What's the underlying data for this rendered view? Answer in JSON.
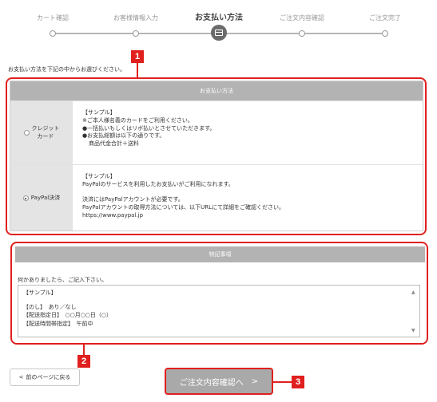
{
  "steps": [
    {
      "label": "カート確認",
      "active": false
    },
    {
      "label": "お客様情報入力",
      "active": false
    },
    {
      "label": "お支払い方法",
      "active": true
    },
    {
      "label": "ご注文内容確認",
      "active": false
    },
    {
      "label": "ご注文完了",
      "active": false
    }
  ],
  "instruction": "お支払い方法を下記の中からお選びください。",
  "payment": {
    "header": "お支払い方法",
    "options": [
      {
        "label_line1": "クレジット",
        "label_line2": "カード",
        "selected": false,
        "lines": [
          "【サンプル】",
          "※ご本人様名義のカードをご利用ください。",
          "●一括払いもしくはリボ払いとさせていただきます。",
          "●お支払総額は以下の通りです。",
          "商品代金合計＋送料"
        ]
      },
      {
        "label_line1": "PayPal決済",
        "selected": true,
        "lines": [
          "【サンプル】",
          "PayPalのサービスを利用したお支払いがご利用になれます。",
          "",
          "決済にはPayPalアカウントが必要です。",
          "PayPalアカウントの取得方法については、以下URLにて詳細をご確認ください。",
          "https://www.paypal.jp"
        ]
      }
    ]
  },
  "notes": {
    "header": "特記事項",
    "prompt": "何かありましたら、ご記入下さい。",
    "value_lines": [
      "【サンプル】",
      "",
      "【のし】　あり／なし",
      "【配送指定日】　○○月○○日（○）",
      "【配送時間帯指定】　午前中"
    ]
  },
  "buttons": {
    "back": "前のページに戻る",
    "back_icon": "<",
    "confirm": "ご注文内容確認へ",
    "confirm_icon": ">"
  },
  "callouts": [
    "1",
    "2",
    "3"
  ],
  "colors": {
    "annotation_red": "#e0201e",
    "header_gray": "#b3b3b3",
    "button_gray": "#a9a9a9"
  }
}
